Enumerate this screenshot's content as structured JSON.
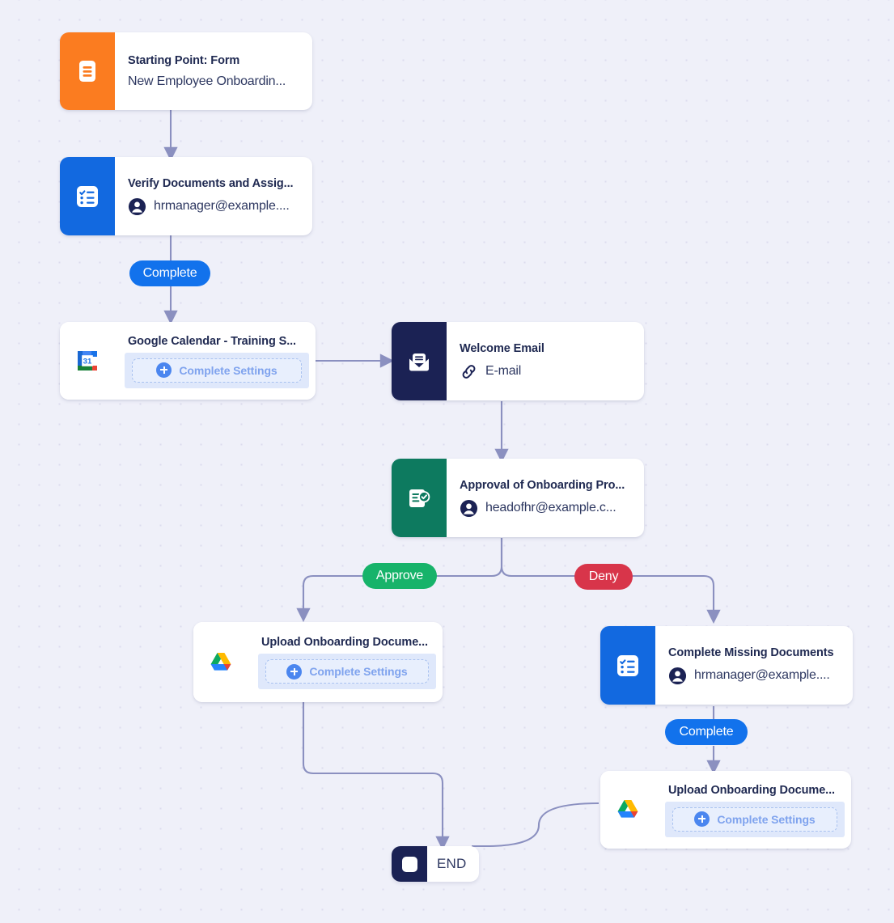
{
  "canvas": {
    "background_color": "#eff0f9",
    "dot_color": "#dcdcee",
    "edge_color": "#8b90c0"
  },
  "nodes": {
    "start_form": {
      "title": "Starting Point: Form",
      "subtitle": "New Employee Onboardin...",
      "icon": "form-document-icon",
      "accent": "#fb7c20"
    },
    "verify_documents": {
      "title": "Verify Documents and Assig...",
      "subtitle": "hrmanager@example....",
      "icon": "checklist-icon",
      "sub_icon": "person-icon",
      "accent": "#1269e0"
    },
    "google_calendar": {
      "title": "Google Calendar - Training S...",
      "button_label": "Complete Settings",
      "icon": "google-calendar-icon",
      "button_icon": "plus-circle-icon"
    },
    "welcome_email": {
      "title": "Welcome Email",
      "subtitle": "E-mail",
      "icon": "envelope-icon",
      "sub_icon": "link-icon",
      "accent": "#1b2254"
    },
    "approval": {
      "title": "Approval of Onboarding Pro...",
      "subtitle": "headofhr@example.c...",
      "icon": "approval-document-icon",
      "sub_icon": "person-icon",
      "accent": "#0d7a5f"
    },
    "upload_left": {
      "title": "Upload Onboarding Docume...",
      "button_label": "Complete Settings",
      "icon": "google-drive-icon",
      "button_icon": "plus-circle-icon"
    },
    "complete_missing": {
      "title": "Complete Missing Documents",
      "subtitle": "hrmanager@example....",
      "icon": "checklist-icon",
      "sub_icon": "person-icon",
      "accent": "#1269e0"
    },
    "upload_right": {
      "title": "Upload Onboarding Docume...",
      "button_label": "Complete Settings",
      "icon": "google-drive-icon",
      "button_icon": "plus-circle-icon"
    },
    "end": {
      "label": "END",
      "icon": "stop-square-icon",
      "accent": "#1b2254"
    }
  },
  "edge_labels": {
    "complete_top": "Complete",
    "approve": "Approve",
    "deny": "Deny",
    "complete_bottom": "Complete"
  }
}
